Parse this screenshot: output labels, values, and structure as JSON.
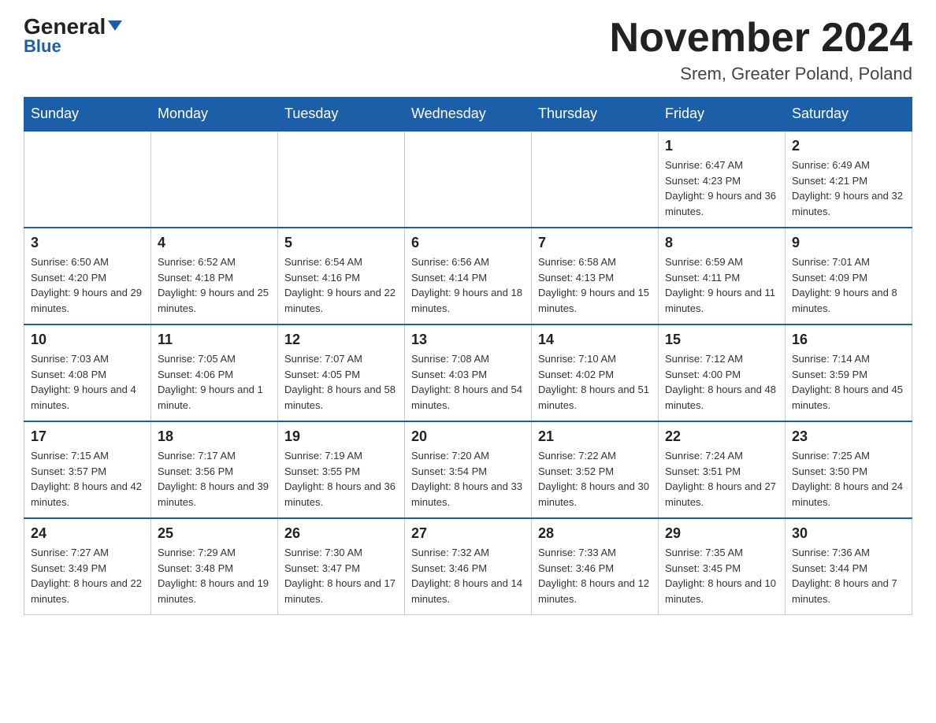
{
  "header": {
    "logo_general": "General",
    "logo_blue": "Blue",
    "month": "November 2024",
    "location": "Srem, Greater Poland, Poland"
  },
  "days_of_week": [
    "Sunday",
    "Monday",
    "Tuesday",
    "Wednesday",
    "Thursday",
    "Friday",
    "Saturday"
  ],
  "weeks": [
    [
      {
        "day": "",
        "info": ""
      },
      {
        "day": "",
        "info": ""
      },
      {
        "day": "",
        "info": ""
      },
      {
        "day": "",
        "info": ""
      },
      {
        "day": "",
        "info": ""
      },
      {
        "day": "1",
        "info": "Sunrise: 6:47 AM\nSunset: 4:23 PM\nDaylight: 9 hours and 36 minutes."
      },
      {
        "day": "2",
        "info": "Sunrise: 6:49 AM\nSunset: 4:21 PM\nDaylight: 9 hours and 32 minutes."
      }
    ],
    [
      {
        "day": "3",
        "info": "Sunrise: 6:50 AM\nSunset: 4:20 PM\nDaylight: 9 hours and 29 minutes."
      },
      {
        "day": "4",
        "info": "Sunrise: 6:52 AM\nSunset: 4:18 PM\nDaylight: 9 hours and 25 minutes."
      },
      {
        "day": "5",
        "info": "Sunrise: 6:54 AM\nSunset: 4:16 PM\nDaylight: 9 hours and 22 minutes."
      },
      {
        "day": "6",
        "info": "Sunrise: 6:56 AM\nSunset: 4:14 PM\nDaylight: 9 hours and 18 minutes."
      },
      {
        "day": "7",
        "info": "Sunrise: 6:58 AM\nSunset: 4:13 PM\nDaylight: 9 hours and 15 minutes."
      },
      {
        "day": "8",
        "info": "Sunrise: 6:59 AM\nSunset: 4:11 PM\nDaylight: 9 hours and 11 minutes."
      },
      {
        "day": "9",
        "info": "Sunrise: 7:01 AM\nSunset: 4:09 PM\nDaylight: 9 hours and 8 minutes."
      }
    ],
    [
      {
        "day": "10",
        "info": "Sunrise: 7:03 AM\nSunset: 4:08 PM\nDaylight: 9 hours and 4 minutes."
      },
      {
        "day": "11",
        "info": "Sunrise: 7:05 AM\nSunset: 4:06 PM\nDaylight: 9 hours and 1 minute."
      },
      {
        "day": "12",
        "info": "Sunrise: 7:07 AM\nSunset: 4:05 PM\nDaylight: 8 hours and 58 minutes."
      },
      {
        "day": "13",
        "info": "Sunrise: 7:08 AM\nSunset: 4:03 PM\nDaylight: 8 hours and 54 minutes."
      },
      {
        "day": "14",
        "info": "Sunrise: 7:10 AM\nSunset: 4:02 PM\nDaylight: 8 hours and 51 minutes."
      },
      {
        "day": "15",
        "info": "Sunrise: 7:12 AM\nSunset: 4:00 PM\nDaylight: 8 hours and 48 minutes."
      },
      {
        "day": "16",
        "info": "Sunrise: 7:14 AM\nSunset: 3:59 PM\nDaylight: 8 hours and 45 minutes."
      }
    ],
    [
      {
        "day": "17",
        "info": "Sunrise: 7:15 AM\nSunset: 3:57 PM\nDaylight: 8 hours and 42 minutes."
      },
      {
        "day": "18",
        "info": "Sunrise: 7:17 AM\nSunset: 3:56 PM\nDaylight: 8 hours and 39 minutes."
      },
      {
        "day": "19",
        "info": "Sunrise: 7:19 AM\nSunset: 3:55 PM\nDaylight: 8 hours and 36 minutes."
      },
      {
        "day": "20",
        "info": "Sunrise: 7:20 AM\nSunset: 3:54 PM\nDaylight: 8 hours and 33 minutes."
      },
      {
        "day": "21",
        "info": "Sunrise: 7:22 AM\nSunset: 3:52 PM\nDaylight: 8 hours and 30 minutes."
      },
      {
        "day": "22",
        "info": "Sunrise: 7:24 AM\nSunset: 3:51 PM\nDaylight: 8 hours and 27 minutes."
      },
      {
        "day": "23",
        "info": "Sunrise: 7:25 AM\nSunset: 3:50 PM\nDaylight: 8 hours and 24 minutes."
      }
    ],
    [
      {
        "day": "24",
        "info": "Sunrise: 7:27 AM\nSunset: 3:49 PM\nDaylight: 8 hours and 22 minutes."
      },
      {
        "day": "25",
        "info": "Sunrise: 7:29 AM\nSunset: 3:48 PM\nDaylight: 8 hours and 19 minutes."
      },
      {
        "day": "26",
        "info": "Sunrise: 7:30 AM\nSunset: 3:47 PM\nDaylight: 8 hours and 17 minutes."
      },
      {
        "day": "27",
        "info": "Sunrise: 7:32 AM\nSunset: 3:46 PM\nDaylight: 8 hours and 14 minutes."
      },
      {
        "day": "28",
        "info": "Sunrise: 7:33 AM\nSunset: 3:46 PM\nDaylight: 8 hours and 12 minutes."
      },
      {
        "day": "29",
        "info": "Sunrise: 7:35 AM\nSunset: 3:45 PM\nDaylight: 8 hours and 10 minutes."
      },
      {
        "day": "30",
        "info": "Sunrise: 7:36 AM\nSunset: 3:44 PM\nDaylight: 8 hours and 7 minutes."
      }
    ]
  ]
}
